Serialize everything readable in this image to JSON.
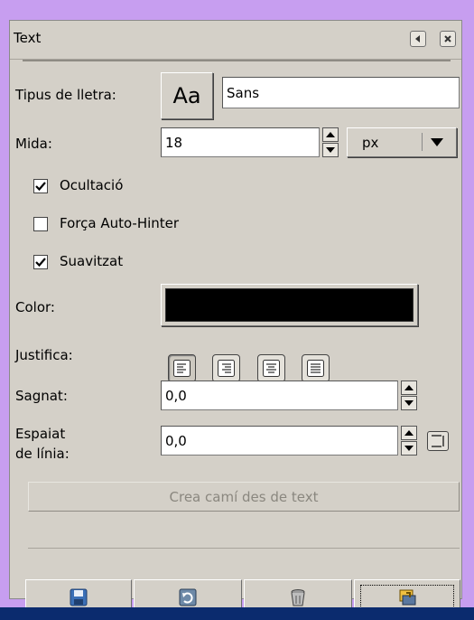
{
  "panel": {
    "title": "Text"
  },
  "font": {
    "label": "Tipus de lletra:",
    "preview": "Aa",
    "value": "Sans"
  },
  "size": {
    "label": "Mida:",
    "value": "18",
    "unit": "px"
  },
  "options": [
    {
      "label": "Ocultació",
      "checked": true
    },
    {
      "label": "Força Auto-Hinter",
      "checked": false
    },
    {
      "label": "Suavitzat",
      "checked": true
    }
  ],
  "color": {
    "label": "Color:",
    "value": "#000000"
  },
  "justify": {
    "label": "Justifica:",
    "selected": "left"
  },
  "indent": {
    "label": "Sagnat:",
    "value": "0,0"
  },
  "line_spacing": {
    "label_line1": "Espaiat",
    "label_line2": "de línia:",
    "value": "0,0"
  },
  "path_button": {
    "label": "Crea camí des de text"
  },
  "icons": {
    "save": "save-icon",
    "restore": "restore-icon",
    "delete": "trash-icon",
    "reset": "reset-icon"
  }
}
